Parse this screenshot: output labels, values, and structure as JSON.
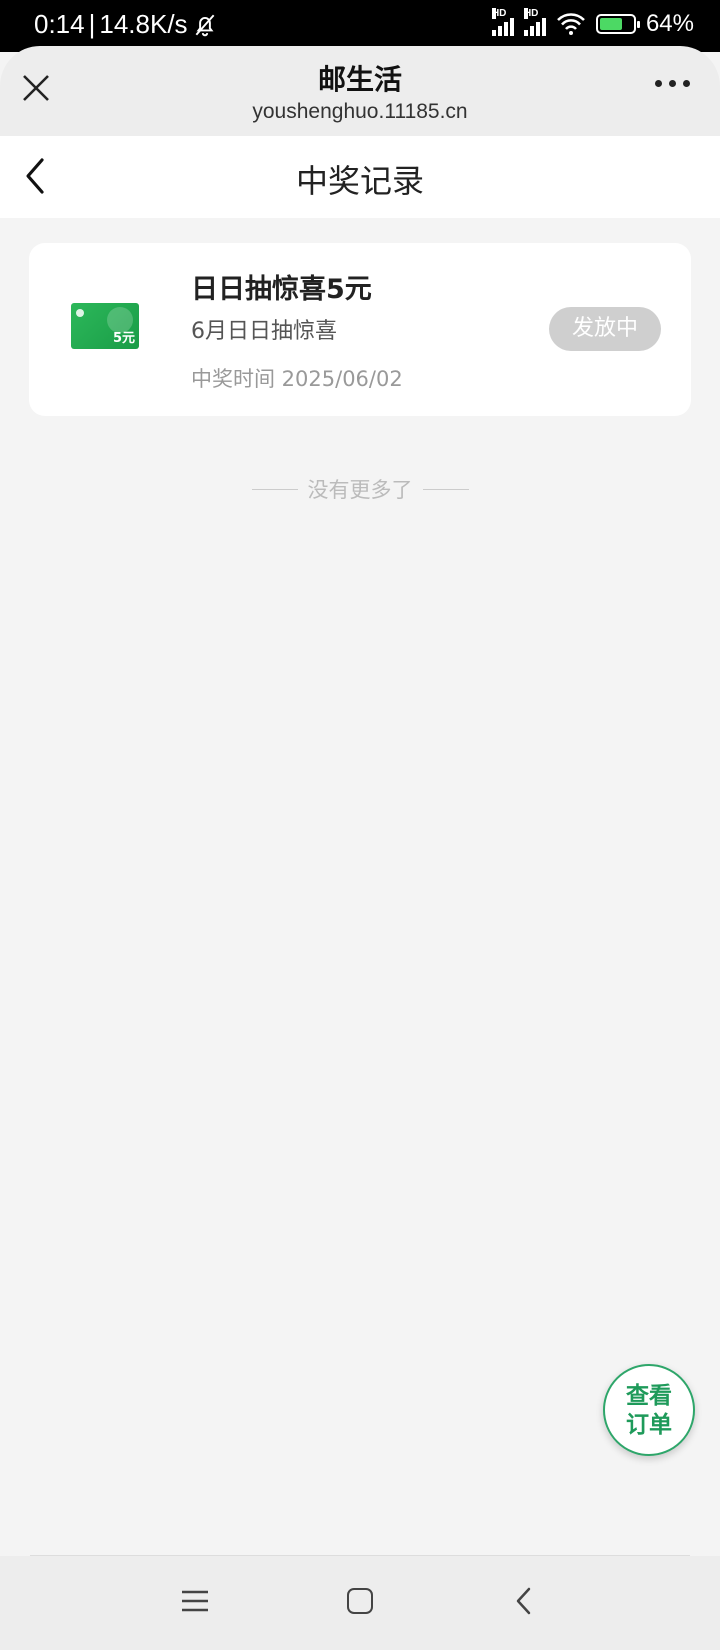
{
  "status_bar": {
    "time": "0:14",
    "network_speed": "14.8K/s",
    "hd_label": "HD",
    "battery": "64%"
  },
  "browser": {
    "site_title": "邮生活",
    "site_url": "youshenghuo.11185.cn"
  },
  "page": {
    "title": "中奖记录"
  },
  "records": [
    {
      "prize_name": "日日抽惊喜5元",
      "activity": "6月日日抽惊喜",
      "time": "中奖时间 2025/06/02",
      "status": "发放中",
      "thumb_value": "5元"
    }
  ],
  "list_end": "没有更多了",
  "fab": {
    "line1": "查看",
    "line2": "订单"
  },
  "colors": {
    "accent_green": "#1e9a5a",
    "pill_gray": "#cfcfcf"
  }
}
